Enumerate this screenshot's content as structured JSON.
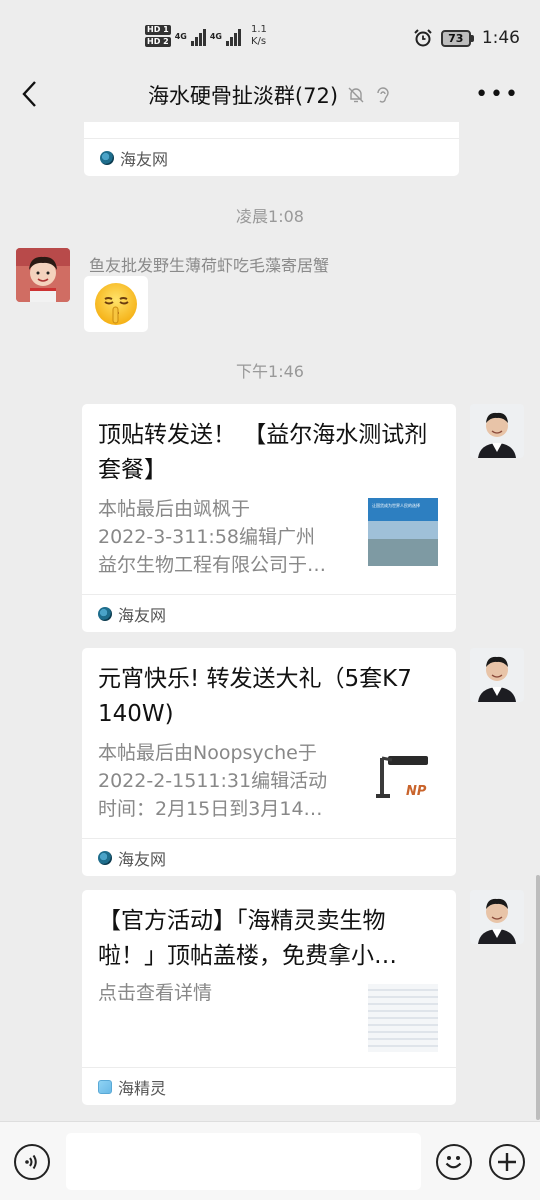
{
  "status_bar": {
    "hd1": "HD 1",
    "hd2": "HD 2",
    "net1": "4G",
    "net2": "4G",
    "speed_value": "1.1",
    "speed_unit": "K/s",
    "battery": "73",
    "time": "1:46"
  },
  "nav": {
    "title": "海水硬骨扯淡群(72)"
  },
  "messages": {
    "top_card_source": "海友网",
    "time1": "凌晨1:08",
    "sender_name": "鱼友批发野生薄荷虾吃毛藻寄居蟹",
    "time2": "下午1:46",
    "card1": {
      "title": "顶贴转发送！ 【益尔海水测试剂套餐】",
      "desc_lines": [
        "本帖最后由飒枫于",
        "2022-3-311:58编辑广州",
        "益尔生物工程有限公司于…"
      ],
      "thumb_text": "让国货成为世界人民的选择",
      "source": "海友网"
    },
    "card2": {
      "title": "元宵快乐! 转发送大礼（5套K7 140W)",
      "desc_lines": [
        "本帖最后由Noopsyche于",
        "2022-2-1511:31编辑活动",
        "时间：2月15日到3月14…"
      ],
      "thumb_text": "NP",
      "source": "海友网"
    },
    "card3": {
      "title_line1": "【官方活动】「海精灵卖生物",
      "title_line2": "啦！」顶帖盖楼，免费拿小…",
      "desc": "点击查看详情",
      "source": "海精灵"
    }
  },
  "colors": {
    "background": "#ededed",
    "bubble": "#ffffff",
    "muted_text": "#888888"
  }
}
